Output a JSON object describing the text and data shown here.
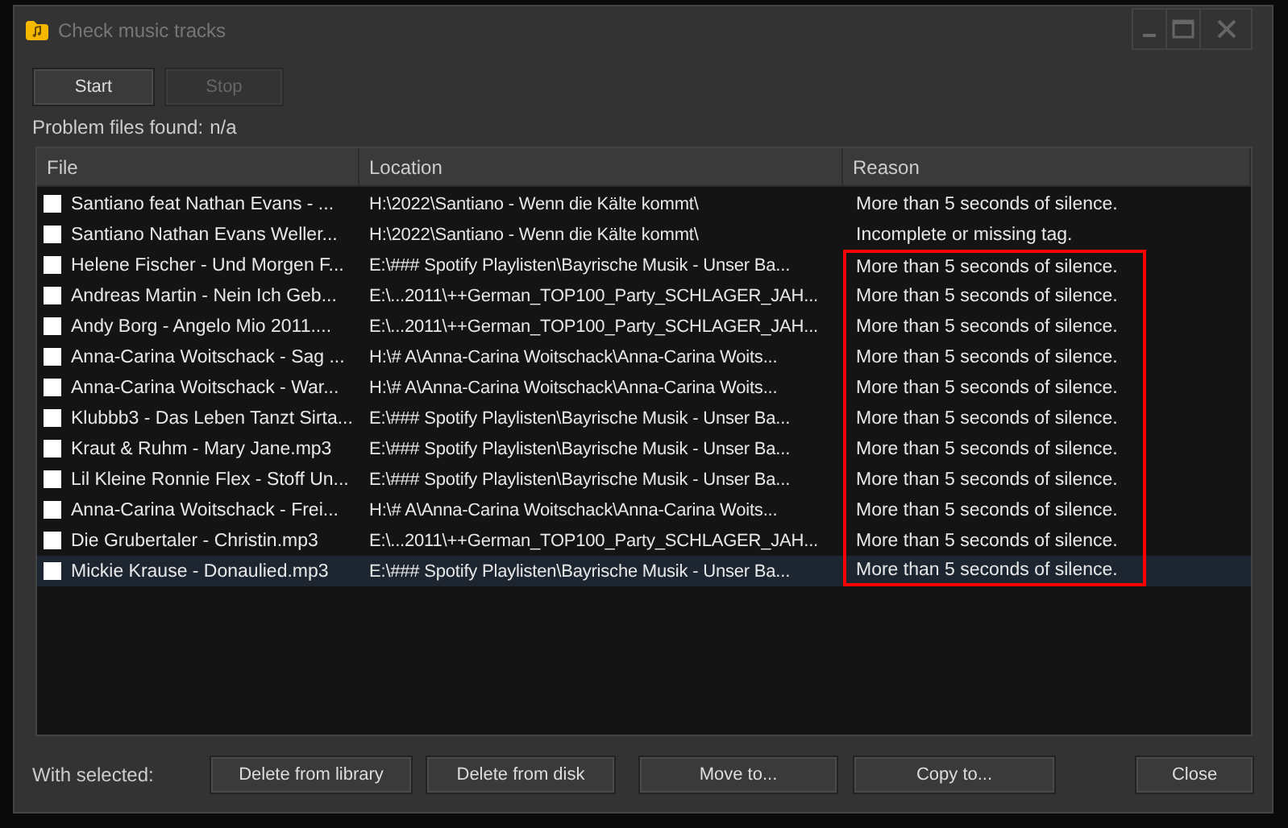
{
  "window": {
    "title": "Check music tracks"
  },
  "toolbar": {
    "buttons": [
      {
        "label": "Start",
        "disabled": false
      },
      {
        "label": "Stop",
        "disabled": true
      }
    ]
  },
  "status": {
    "label": "Problem files found:",
    "value": "n/a"
  },
  "table": {
    "columns": [
      "File",
      "Location",
      "Reason"
    ],
    "rows": [
      {
        "file": "Santiano feat Nathan Evans - ...",
        "location": "H:\\2022\\Santiano - Wenn die Kälte kommt\\",
        "reason": "More than 5 seconds of silence.",
        "checked": false,
        "selected": false,
        "highlighted": false
      },
      {
        "file": "Santiano Nathan Evans Weller...",
        "location": "H:\\2022\\Santiano - Wenn die Kälte kommt\\",
        "reason": "Incomplete or missing tag.",
        "checked": false,
        "selected": false,
        "highlighted": false
      },
      {
        "file": "Helene Fischer - Und Morgen F...",
        "location": "E:\\### Spotify Playlisten\\Bayrische Musik - Unser Ba...",
        "reason": "More than 5 seconds of silence.",
        "checked": false,
        "selected": false,
        "highlighted": true
      },
      {
        "file": "Andreas Martin - Nein  Ich Geb...",
        "location": "E:\\...2011\\++German_TOP100_Party_SCHLAGER_JAH...",
        "reason": "More than 5 seconds of silence.",
        "checked": false,
        "selected": false,
        "highlighted": true
      },
      {
        "file": "Andy Borg - Angelo Mio 2011....",
        "location": "E:\\...2011\\++German_TOP100_Party_SCHLAGER_JAH...",
        "reason": "More than 5 seconds of silence.",
        "checked": false,
        "selected": false,
        "highlighted": true
      },
      {
        "file": "Anna-Carina Woitschack - Sag ...",
        "location": "H:\\# A\\Anna-Carina Woitschack\\Anna-Carina Woits...",
        "reason": "More than 5 seconds of silence.",
        "checked": false,
        "selected": false,
        "highlighted": true
      },
      {
        "file": "Anna-Carina Woitschack - War...",
        "location": "H:\\# A\\Anna-Carina Woitschack\\Anna-Carina Woits...",
        "reason": "More than 5 seconds of silence.",
        "checked": false,
        "selected": false,
        "highlighted": true
      },
      {
        "file": "Klubbb3 - Das Leben Tanzt Sirta...",
        "location": "E:\\### Spotify Playlisten\\Bayrische Musik - Unser Ba...",
        "reason": "More than 5 seconds of silence.",
        "checked": false,
        "selected": false,
        "highlighted": true
      },
      {
        "file": "Kraut & Ruhm - Mary Jane.mp3",
        "location": "E:\\### Spotify Playlisten\\Bayrische Musik - Unser Ba...",
        "reason": "More than 5 seconds of silence.",
        "checked": false,
        "selected": false,
        "highlighted": true
      },
      {
        "file": "Lil Kleine Ronnie Flex - Stoff Un...",
        "location": "E:\\### Spotify Playlisten\\Bayrische Musik - Unser Ba...",
        "reason": "More than 5 seconds of silence.",
        "checked": false,
        "selected": false,
        "highlighted": true
      },
      {
        "file": "Anna-Carina Woitschack - Frei...",
        "location": "H:\\# A\\Anna-Carina Woitschack\\Anna-Carina Woits...",
        "reason": "More than 5 seconds of silence.",
        "checked": false,
        "selected": false,
        "highlighted": true
      },
      {
        "file": "Die Grubertaler - Christin.mp3",
        "location": "E:\\...2011\\++German_TOP100_Party_SCHLAGER_JAH...",
        "reason": "More than 5 seconds of silence.",
        "checked": false,
        "selected": false,
        "highlighted": true
      },
      {
        "file": "Mickie Krause - Donaulied.mp3",
        "location": "E:\\### Spotify Playlisten\\Bayrische Musik - Unser Ba...",
        "reason": "More than 5 seconds of silence.",
        "checked": false,
        "selected": true,
        "highlighted": true
      }
    ]
  },
  "footer": {
    "label": "With selected:",
    "actions": [
      "Delete from library",
      "Delete from disk",
      "Move to...",
      "Copy to..."
    ],
    "close": "Close"
  }
}
